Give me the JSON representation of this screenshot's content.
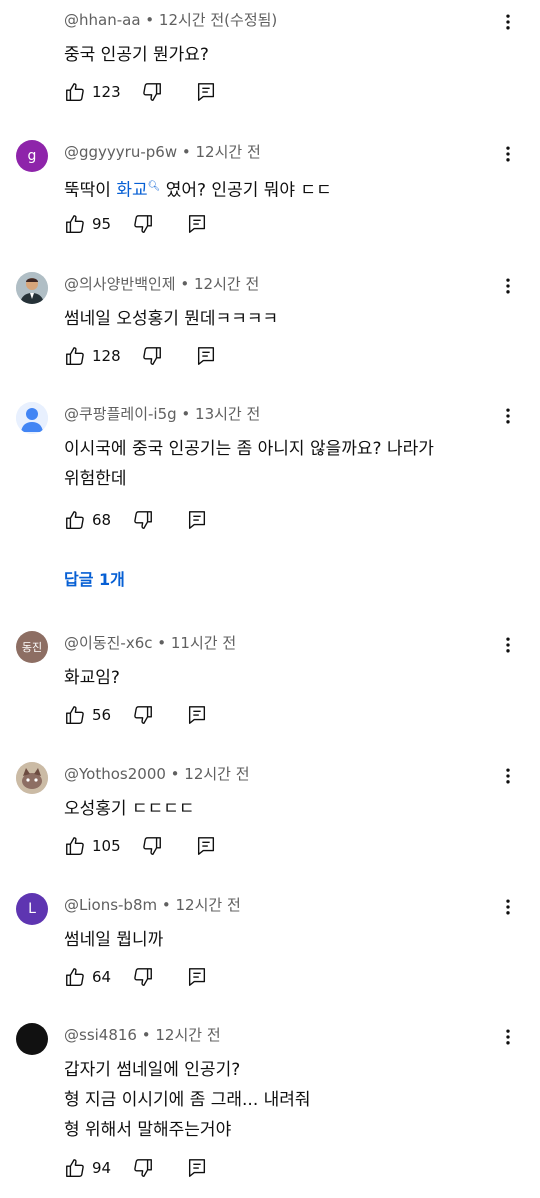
{
  "colors": {
    "link": "#065fd4",
    "meta": "#606060",
    "text": "#0f0f0f"
  },
  "comments": [
    {
      "author": "@hhan-aa",
      "time": "12시간 전(수정됨)",
      "lines": [
        "중국 인공기 뭔가요?"
      ],
      "likes": "123",
      "avatar_icon": "none"
    },
    {
      "author": "@ggyyyru-p6w",
      "time": "12시간 전",
      "text_before": "뚝딱이 ",
      "text_link": "화교",
      "text_after": " 였어? 인공기 뭐야 ㄷㄷ",
      "likes": "95",
      "avatar_letter": "g",
      "avatar_color": "#8e24aa"
    },
    {
      "author": "@의사양반백인제",
      "time": "12시간 전",
      "lines": [
        "썸네일 오성홍기 뭔데ㅋㅋㅋㅋ"
      ],
      "likes": "128",
      "avatar_icon": "man-in-suit-avatar"
    },
    {
      "author": "@쿠팡플레이-i5g",
      "time": "13시간 전",
      "lines": [
        "이시국에 중국 인공기는 좀 아니지 않을까요? 나라가",
        "위험한데"
      ],
      "likes": "68",
      "avatar_icon": "default-user-avatar",
      "reply_label": "답글 1개"
    },
    {
      "author": "@이동진-x6c",
      "time": "11시간 전",
      "lines": [
        "화교임?"
      ],
      "likes": "56",
      "avatar_letter": "동진",
      "avatar_color": "#8d6e63"
    },
    {
      "author": "@Yothos2000",
      "time": "12시간 전",
      "lines": [
        "오성홍기 ㄷㄷㄷㄷ"
      ],
      "likes": "105",
      "avatar_icon": "cat-avatar"
    },
    {
      "author": "@Lions-b8m",
      "time": "12시간 전",
      "lines": [
        "썸네일 뭡니까"
      ],
      "likes": "64",
      "avatar_letter": "L",
      "avatar_color": "#5e35b1"
    },
    {
      "author": "@ssi4816",
      "time": "12시간 전",
      "lines": [
        "갑자기 썸네일에 인공기?",
        "형 지금 이시기에 좀 그래... 내려줘",
        "형 위해서 말해주는거야"
      ],
      "likes": "94",
      "avatar_color": "#111111"
    }
  ],
  "separator": " • ",
  "icons": [
    "thumbs-up-icon",
    "thumbs-down-icon",
    "reply-icon",
    "more-vert-icon"
  ]
}
